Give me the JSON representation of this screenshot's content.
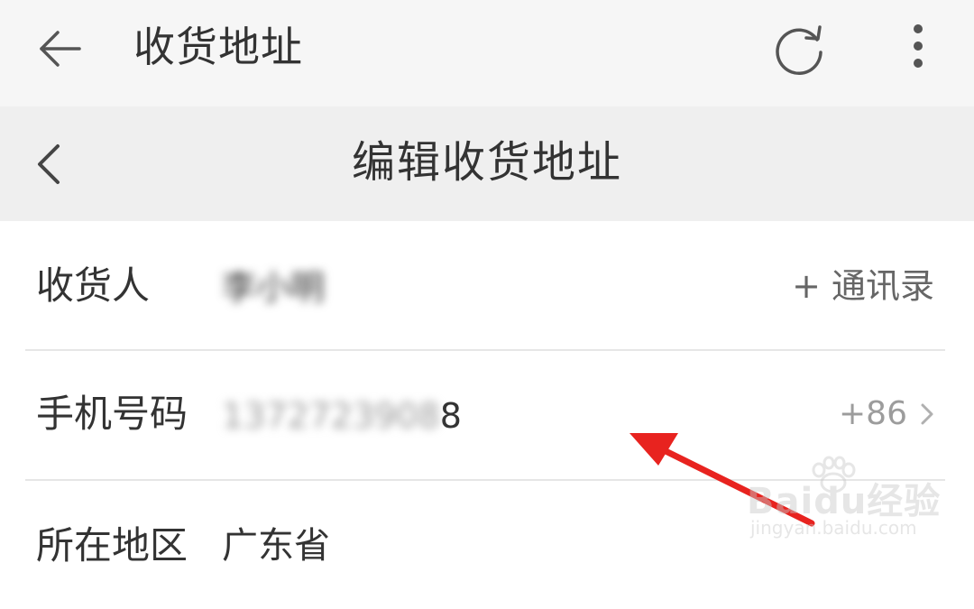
{
  "header": {
    "title": "收货地址",
    "back_icon": "arrow-left-icon",
    "refresh_icon": "refresh-icon",
    "more_icon": "more-vertical-icon"
  },
  "subheader": {
    "title": "编辑收货地址",
    "back_icon": "chevron-left-icon"
  },
  "form": {
    "recipient": {
      "label": "收货人",
      "value": "李小明",
      "contacts": "+ 通讯录"
    },
    "phone": {
      "label": "手机号码",
      "value_masked": "1372723908",
      "value_last": "8",
      "country_code": "+86"
    },
    "region": {
      "label": "所在地区",
      "value": "广东省"
    }
  },
  "watermark": {
    "brand": "Baidu经验",
    "url": "jingyan.baidu.com"
  },
  "colors": {
    "annotation_arrow": "#e8231f",
    "topbar_bg": "#f6f6f6",
    "subbar_bg": "#efefef"
  }
}
